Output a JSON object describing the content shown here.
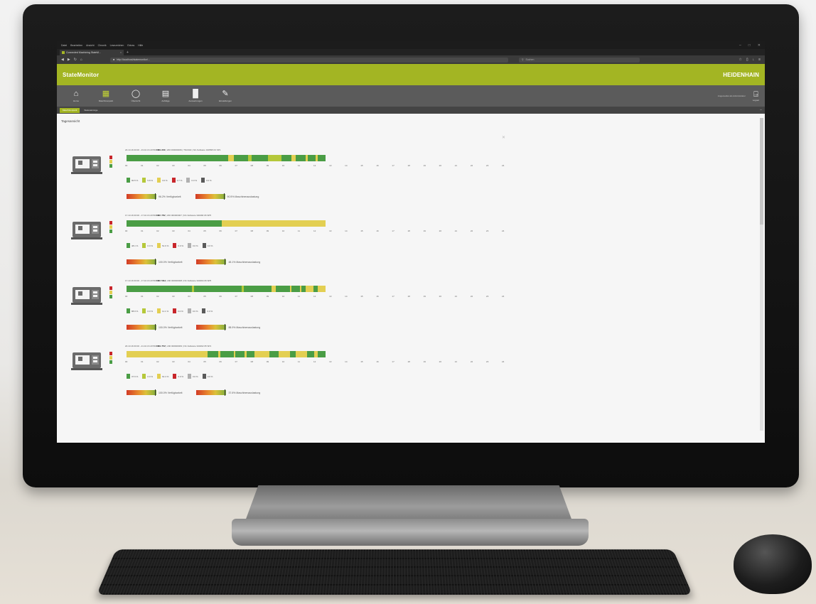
{
  "browser": {
    "menu": [
      "Datei",
      "Bearbeiten",
      "Ansicht",
      "Chronik",
      "Lesezeichen",
      "Extras",
      "Hilfe"
    ],
    "tab_label": "Connected Machining StateM...",
    "url": "http://localhost/statemonitor/...",
    "search_placeholder": "Suchen"
  },
  "app": {
    "logo": "StateMonitor",
    "brand": "HEIDENHAIN"
  },
  "toolbar": {
    "items": [
      {
        "label": "Home",
        "icon": "home-icon",
        "glyph": "⌂"
      },
      {
        "label": "Maschinenpark",
        "icon": "machine-park-icon",
        "glyph": "▦",
        "active": true
      },
      {
        "label": "Übersicht",
        "icon": "overview-icon",
        "glyph": "◯"
      },
      {
        "label": "Aufträge",
        "icon": "document-icon",
        "glyph": "▤"
      },
      {
        "label": "Auswertungen",
        "icon": "bar-chart-icon",
        "glyph": "▐▌"
      },
      {
        "label": "Einstellungen",
        "icon": "tools-icon",
        "glyph": "✎"
      }
    ],
    "user_text": "Angemeldet als Administrator",
    "logout_label": "Logout"
  },
  "subtabs": [
    "Maschinenpark",
    "Statusanzeige"
  ],
  "page": {
    "section_title": "Tagesansicht"
  },
  "status_colors": {
    "production": "#4a9d45",
    "ready": "#b5c83a",
    "idle": "#e3cf52",
    "alarm": "#c8262b",
    "off": "#b0b0b0",
    "unknown": "#5a5a5a"
  },
  "hour_labels": [
    "00",
    "01",
    "02",
    "03",
    "04",
    "05",
    "06",
    "07",
    "08",
    "09",
    "10",
    "11",
    "12",
    "13",
    "14",
    "15",
    "16",
    "17",
    "18",
    "19",
    "20",
    "21",
    "22",
    "23",
    "24"
  ],
  "machines": [
    {
      "info_prefix": "23.10.16 00:00 - 23.10.16 23:59",
      "model": "DMG 200",
      "info_suffix": "| 200 000000006 | TNC640 | NC-Software 340595 03 SP1",
      "timeline": [
        {
          "s": "production",
          "w": 0.51
        },
        {
          "s": "idle",
          "w": 0.03
        },
        {
          "s": "production",
          "w": 0.07
        },
        {
          "s": "ready",
          "w": 0.02
        },
        {
          "s": "production",
          "w": 0.08
        },
        {
          "s": "ready",
          "w": 0.07
        },
        {
          "s": "production",
          "w": 0.05
        },
        {
          "s": "idle",
          "w": 0.02
        },
        {
          "s": "production",
          "w": 0.05
        },
        {
          "s": "idle",
          "w": 0.01
        },
        {
          "s": "production",
          "w": 0.04
        },
        {
          "s": "idle",
          "w": 0.01
        },
        {
          "s": "production",
          "w": 0.04
        }
      ],
      "legend": [
        "90.5 %",
        "5.8 %",
        "3.0 %",
        "0.7 %",
        "0.0 %",
        "0.0 %"
      ],
      "availability": "96.2% Verfügbarkeit",
      "utilization": "90.5% Maschinenauslastung"
    },
    {
      "info_prefix": "17.10.16 00:00 - 17.10.16 23:59",
      "model": "DMC 70V",
      "info_suffix": "| 200 000000007 | NC-Software 340490 06 SP5",
      "timeline": [
        {
          "s": "production",
          "w": 0.48
        },
        {
          "s": "idle",
          "w": 0.52
        }
      ],
      "legend": [
        "48.1 %",
        "0.0 %",
        "51.9 %",
        "0.0 %",
        "0.0 %",
        "0.0 %"
      ],
      "availability": "100.0% Verfügbarkeit",
      "utilization": "48.1% Maschinenauslastung"
    },
    {
      "info_prefix": "17.10.16 00:00 - 17.10.16 23:59",
      "model": "DMC 50H",
      "info_suffix": "| 200 000000008 | NC-Software 340494 06 SP5",
      "timeline": [
        {
          "s": "production",
          "w": 0.33
        },
        {
          "s": "ready",
          "w": 0.01
        },
        {
          "s": "production",
          "w": 0.24
        },
        {
          "s": "ready",
          "w": 0.01
        },
        {
          "s": "production",
          "w": 0.14
        },
        {
          "s": "idle",
          "w": 0.02
        },
        {
          "s": "production",
          "w": 0.07
        },
        {
          "s": "idle",
          "w": 0.01
        },
        {
          "s": "production",
          "w": 0.04
        },
        {
          "s": "idle",
          "w": 0.01
        },
        {
          "s": "production",
          "w": 0.02
        },
        {
          "s": "idle",
          "w": 0.04
        },
        {
          "s": "production",
          "w": 0.02
        },
        {
          "s": "idle",
          "w": 0.04
        }
      ],
      "legend": [
        "88.9 %",
        "0.0 %",
        "11.1 %",
        "0.0 %",
        "0.0 %",
        "0.0 %"
      ],
      "availability": "100.0% Verfügbarkeit",
      "utilization": "88.9% Maschinenauslastung"
    },
    {
      "info_prefix": "20.10.16 00:00 - 21.10.16 23:59",
      "model": "DMG 75V",
      "info_suffix": "| 200 000000009 | NC-Software 340492 05 SP1",
      "timeline": [
        {
          "s": "idle",
          "w": 0.43
        },
        {
          "s": "production",
          "w": 0.06
        },
        {
          "s": "idle",
          "w": 0.01
        },
        {
          "s": "production",
          "w": 0.07
        },
        {
          "s": "idle",
          "w": 0.01
        },
        {
          "s": "production",
          "w": 0.05
        },
        {
          "s": "idle",
          "w": 0.01
        },
        {
          "s": "production",
          "w": 0.04
        },
        {
          "s": "idle",
          "w": 0.08
        },
        {
          "s": "production",
          "w": 0.05
        },
        {
          "s": "idle",
          "w": 0.06
        },
        {
          "s": "production",
          "w": 0.03
        },
        {
          "s": "idle",
          "w": 0.06
        },
        {
          "s": "production",
          "w": 0.04
        },
        {
          "s": "idle",
          "w": 0.02
        },
        {
          "s": "production",
          "w": 0.04
        }
      ],
      "legend": [
        "37.6 %",
        "0.0 %",
        "62.4 %",
        "0.0 %",
        "0.0 %",
        "0.0 %"
      ],
      "availability": "100.0% Verfügbarkeit",
      "utilization": "37.6% Maschinenauslastung"
    }
  ]
}
